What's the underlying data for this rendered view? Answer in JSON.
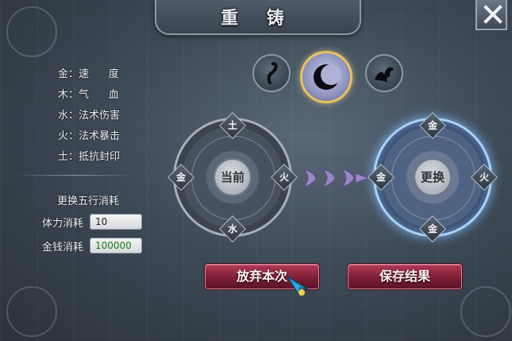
{
  "window": {
    "title": "重 铸"
  },
  "attributes": [
    {
      "element": "金：",
      "value": "速      度"
    },
    {
      "element": "木：",
      "value": "气      血"
    },
    {
      "element": "水：",
      "value": "法术伤害"
    },
    {
      "element": "火：",
      "value": "法术暴击"
    },
    {
      "element": "土：",
      "value": "抵抗封印"
    }
  ],
  "cost": {
    "title": "更换五行消耗",
    "stamina_label": "体力消耗",
    "stamina_value": "10",
    "money_label": "金钱消耗",
    "money_value": "100000"
  },
  "selector": {
    "icons": [
      "brush-icon",
      "moon-icon",
      "beast-icon"
    ],
    "selected": "moon-icon"
  },
  "current_wheel": {
    "center": "当前",
    "top": "土",
    "left": "金",
    "right": "火",
    "bottom": "水"
  },
  "new_wheel": {
    "center": "更换",
    "top": "金",
    "left": "金",
    "right": "火",
    "bottom": "金"
  },
  "buttons": {
    "abandon": "放弃本次",
    "save": "保存结果"
  },
  "colors": {
    "button": "#7e1f35",
    "highlight_glow": "#a9d4f5",
    "gold_text": "#1b7a1b"
  }
}
